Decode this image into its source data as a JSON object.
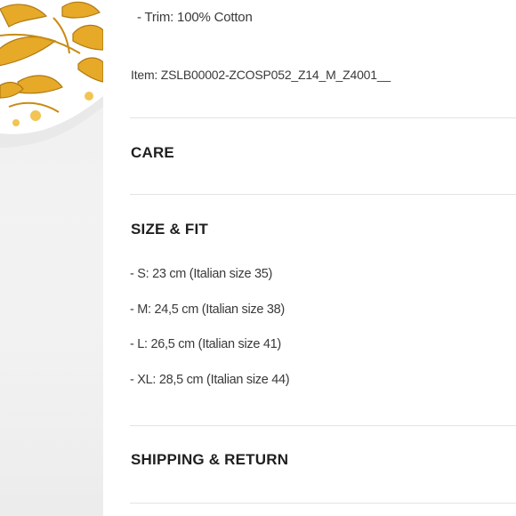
{
  "composition": {
    "trim_line": "- Trim: 100% Cotton",
    "item_code": "Item: ZSLB00002-ZCOSP052_Z14_M_Z4001__"
  },
  "sections": {
    "care": {
      "title": "CARE"
    },
    "size_fit": {
      "title": "SIZE & FIT",
      "items": [
        "- S: 23 cm (Italian size 35)",
        "- M: 24,5 cm (Italian size 38)",
        "- L: 26,5 cm (Italian size 41)",
        "- XL: 28,5 cm (Italian size 44)"
      ]
    },
    "shipping": {
      "title": "SHIPPING & RETURN"
    }
  },
  "colors": {
    "background": "#ffffff",
    "divider": "#e3e3e3",
    "heading": "#1f1f1f",
    "body_text": "#3a3a3a",
    "ornament_gold": "#e0a526",
    "ornament_dark": "#b07a12"
  },
  "image": {
    "subject": "product-image-baroque-gold-pattern"
  }
}
